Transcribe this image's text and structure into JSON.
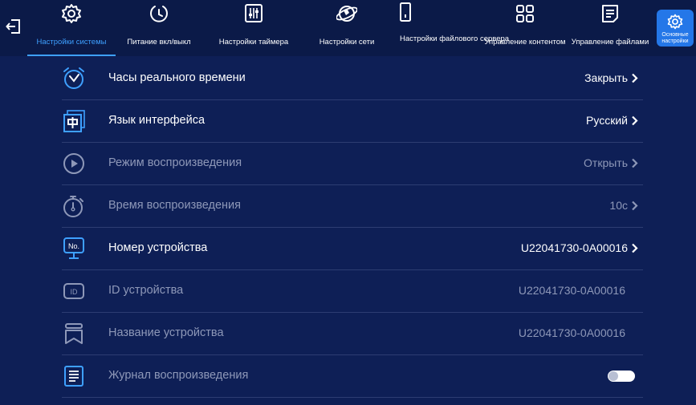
{
  "tabs": [
    {
      "label": "Настройки системы",
      "icon": "gear-icon"
    },
    {
      "label": "Питание вкл/выкл",
      "icon": "power-clock-icon"
    },
    {
      "label": "Настройки таймера",
      "icon": "timer-sliders-icon"
    },
    {
      "label": "Настройки сети",
      "icon": "globe-icon"
    },
    {
      "label": "Настройки файлового сервера",
      "icon": "phone-icon"
    },
    {
      "label": "Управление контентом",
      "icon": "grid-icon"
    },
    {
      "label": "Управление файлами",
      "icon": "file-list-icon"
    }
  ],
  "corner_button": {
    "label": "Основные настройки",
    "icon": "gear-icon"
  },
  "rows": [
    {
      "title": "Часы реального времени",
      "value": "Закрыть",
      "icon": "alarm-clock-icon"
    },
    {
      "title": "Язык интерфейса",
      "value": "Русский",
      "icon": "language-icon"
    },
    {
      "title": "Режим воспроизведения",
      "value": "Открыть",
      "icon": "play-circle-icon"
    },
    {
      "title": "Время воспроизведения",
      "value": "10с",
      "icon": "stopwatch-icon"
    },
    {
      "title": "Номер устройства",
      "value": "U22041730-0A00016",
      "icon": "device-number-icon"
    },
    {
      "title": "ID устройства",
      "value": "U22041730-0A00016",
      "icon": "id-icon"
    },
    {
      "title": "Название устройства",
      "value": "U22041730-0A00016",
      "icon": "bookmark-icon"
    },
    {
      "title": "Журнал воспроизведения",
      "value": "",
      "icon": "log-icon",
      "toggle": "off"
    }
  ],
  "colors": {
    "background": "#0e1f56",
    "accent": "#3ea0ff",
    "dim_text": "#8e98b8"
  }
}
